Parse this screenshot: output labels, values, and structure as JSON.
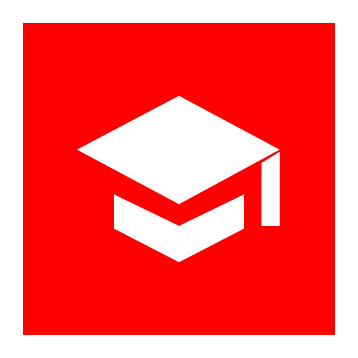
{
  "app_icon": {
    "icon": "graduation-cap-icon",
    "colors": {
      "background": "#ffffff",
      "tile": "#ff0000",
      "glyph": "#ffffff"
    }
  }
}
